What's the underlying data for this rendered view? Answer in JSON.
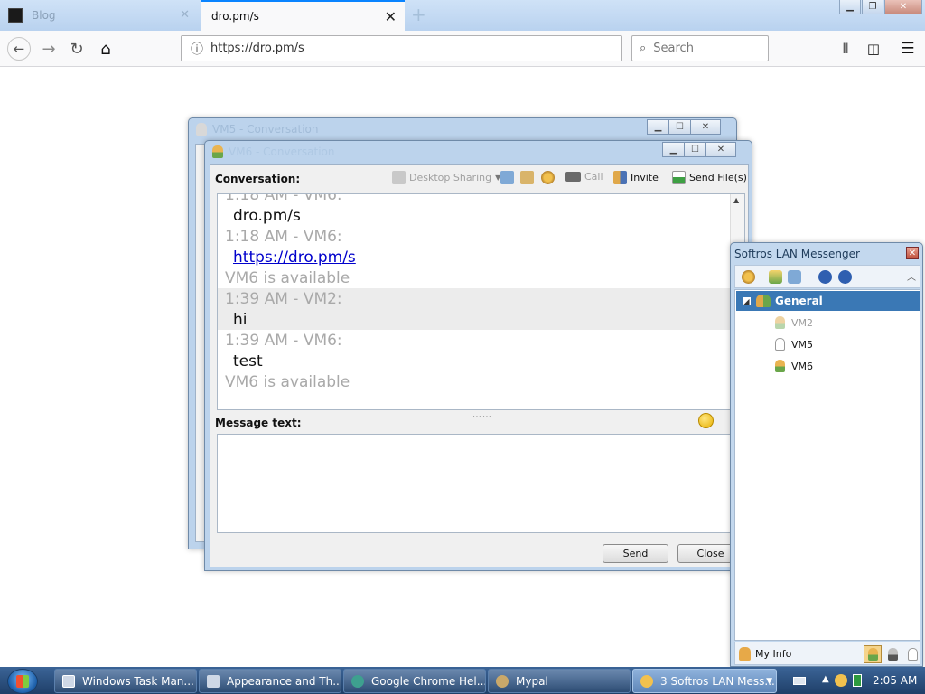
{
  "browser": {
    "tabs": [
      {
        "label": "Blog"
      },
      {
        "label": "dro.pm/s"
      }
    ],
    "url": "https://dro.pm/s",
    "search_placeholder": "Search"
  },
  "vm5_window": {
    "title": "VM5 - Conversation"
  },
  "conversation_window": {
    "title": "VM6 - Conversation",
    "conversation_label": "Conversation:",
    "toolbar": {
      "desktop_sharing": "Desktop Sharing",
      "call": "Call",
      "invite": "Invite",
      "send_files": "Send File(s)"
    },
    "messages": [
      {
        "text": "1:18 AM - VM6:",
        "kind": "meta"
      },
      {
        "text": "dro.pm/s",
        "kind": "body"
      },
      {
        "text": "1:18 AM - VM6:",
        "kind": "meta"
      },
      {
        "text": "https://dro.pm/s",
        "kind": "link"
      },
      {
        "text": "VM6 is available",
        "kind": "meta"
      },
      {
        "text": "1:39 AM - VM2:",
        "kind": "meta"
      },
      {
        "text": "hi",
        "kind": "body"
      },
      {
        "text": "1:39 AM - VM6:",
        "kind": "meta"
      },
      {
        "text": "test",
        "kind": "body"
      },
      {
        "text": "VM6 is available",
        "kind": "meta"
      }
    ],
    "message_label": "Message text:",
    "message_value": "",
    "send_label": "Send",
    "close_label": "Close"
  },
  "lan_messenger": {
    "title": "Softros LAN Messenger",
    "group": "General",
    "contacts": [
      {
        "name": "VM2",
        "status": "offline"
      },
      {
        "name": "VM5",
        "status": "away"
      },
      {
        "name": "VM6",
        "status": "available"
      }
    ],
    "my_info_label": "My Info"
  },
  "taskbar": {
    "tasks": [
      {
        "label": "Windows Task Man..."
      },
      {
        "label": "Appearance and Th..."
      },
      {
        "label": "Google Chrome Hel..."
      },
      {
        "label": "Mypal"
      },
      {
        "label": "3 Softros LAN Mess..."
      }
    ],
    "clock": "2:05 AM"
  },
  "colors": {
    "accent": "#0a84ff",
    "group_highlight": "#3a78b5",
    "link": "#0000cc",
    "meta_text": "#a9a9a9"
  }
}
